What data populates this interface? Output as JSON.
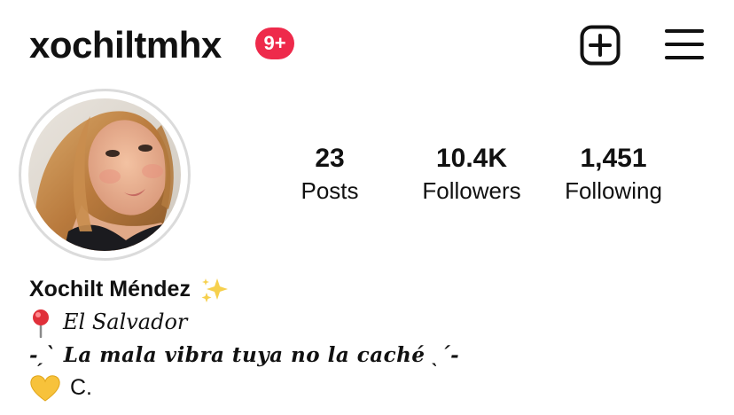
{
  "header": {
    "username": "xochiltmhx",
    "notification_badge": "9+",
    "new_post_icon": "plus-square-icon",
    "menu_icon": "hamburger-menu-icon",
    "badge_color": "#ee2a4b"
  },
  "profile": {
    "avatar_icon": "profile-photo",
    "stats": {
      "posts": {
        "count": "23",
        "label": "Posts"
      },
      "followers": {
        "count": "10.4K",
        "label": "Followers"
      },
      "following": {
        "count": "1,451",
        "label": "Following"
      }
    }
  },
  "bio": {
    "display_name": "Xochilt Méndez",
    "name_emoji": "sparkles-icon",
    "location_emoji": "round-pushpin-icon",
    "location": "El Salvador",
    "quote": "-ˏˋ La mala vibra tuya no la caché ˎˊ-",
    "heart_emoji": "yellow-heart-icon",
    "initial": "C."
  }
}
